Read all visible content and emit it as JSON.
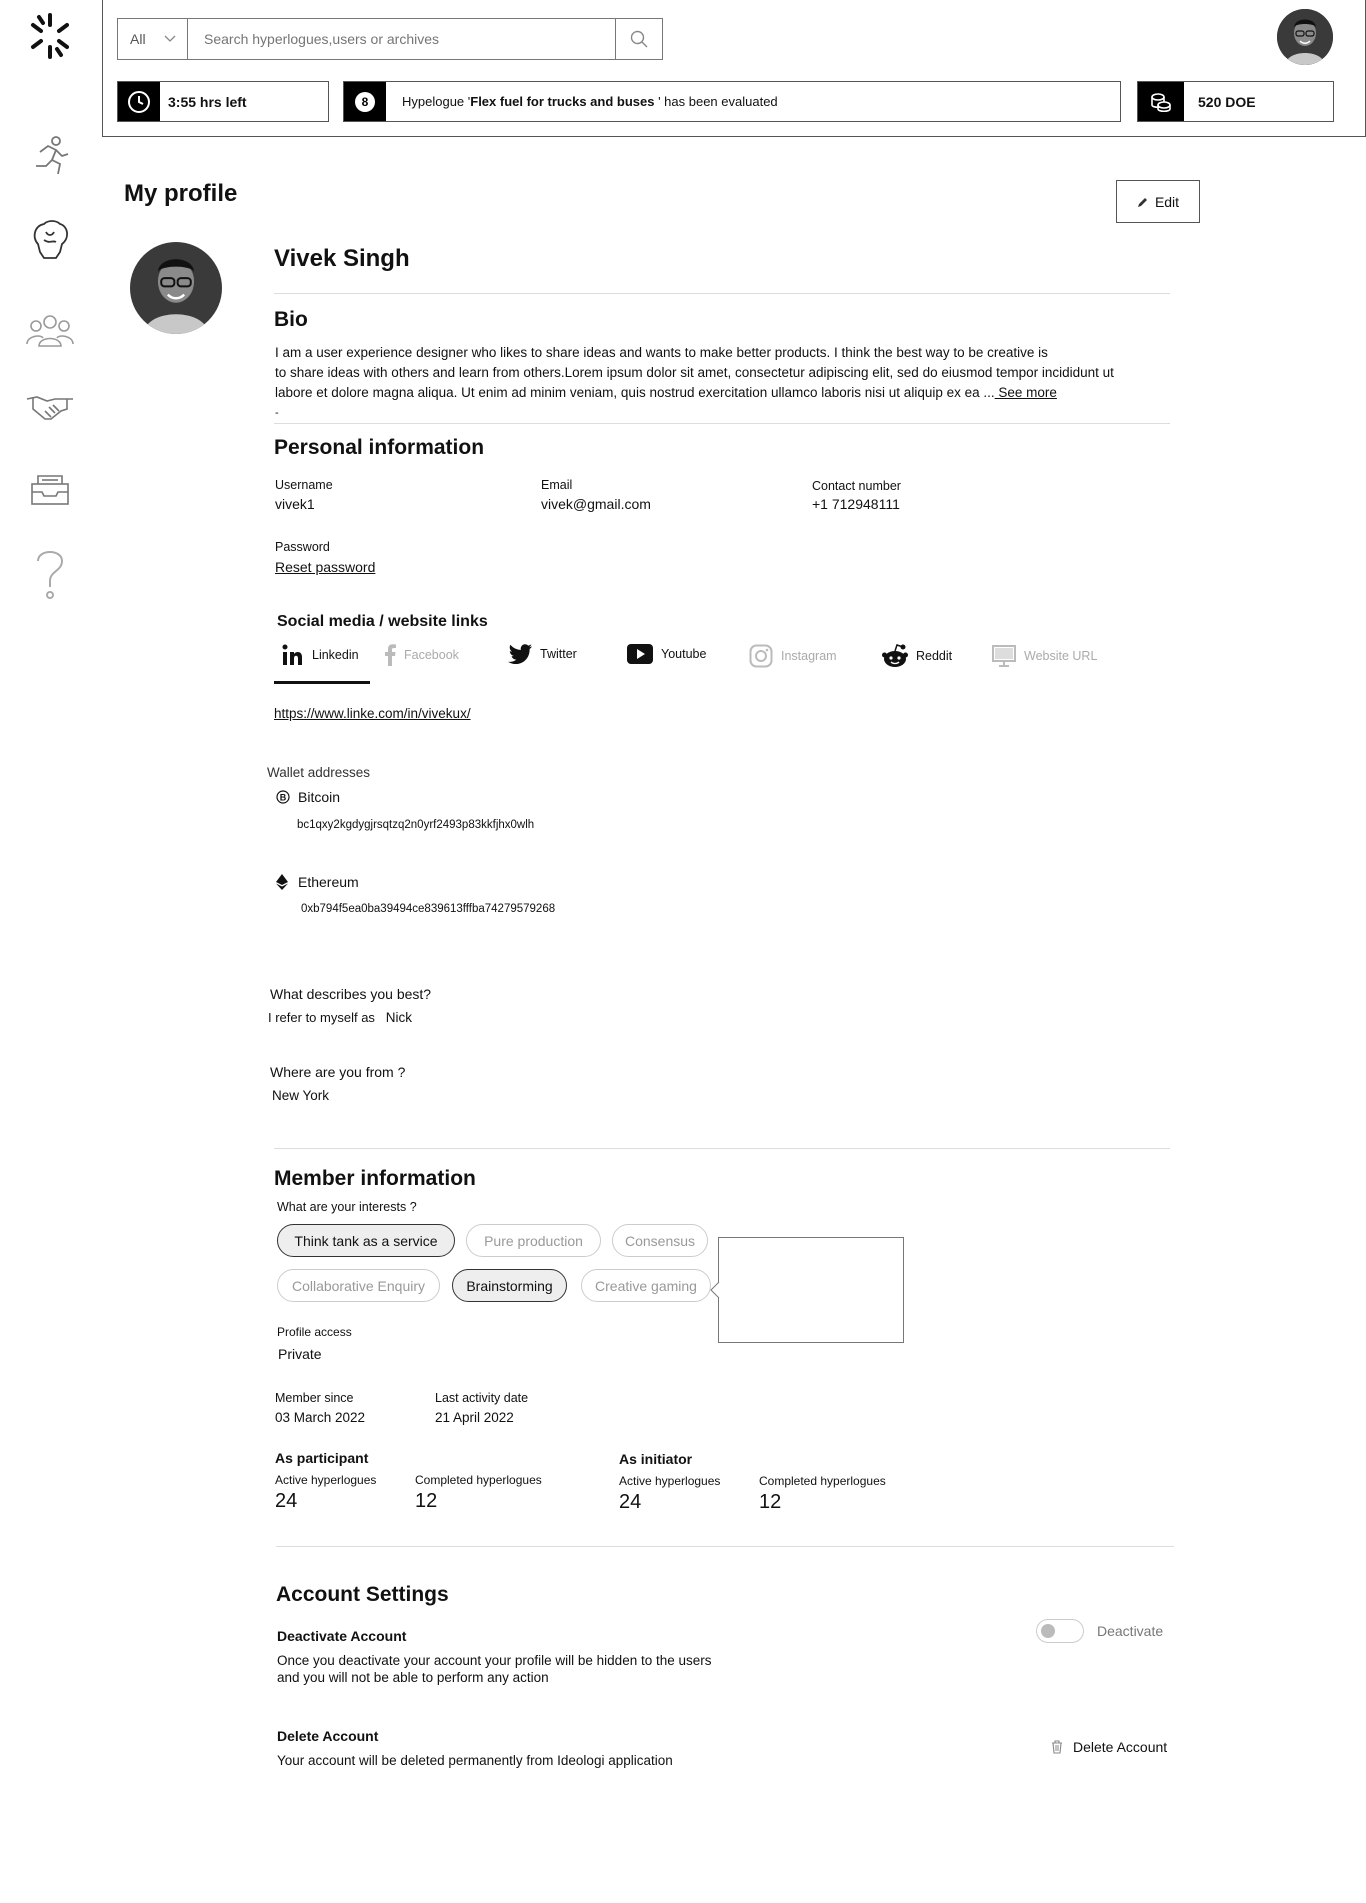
{
  "search": {
    "category": "All",
    "placeholder": "Search hyperlogues,users or archives"
  },
  "status": {
    "time_left": "3:55 hrs left",
    "notification_count": "8",
    "notification_prefix": "Hypelogue '",
    "notification_bold": "Flex fuel for trucks and buses",
    "notification_suffix": " ' has been evaluated",
    "balance": "520 DOE"
  },
  "page": {
    "title": "My profile",
    "edit_label": "Edit"
  },
  "profile": {
    "name": "Vivek Singh",
    "bio_heading": "Bio",
    "bio_line1": "I am a user experience designer who likes to share ideas and wants to make better products. I think the best way to be creative is",
    "bio_line2": "to share ideas with others and learn from others.Lorem ipsum dolor sit amet, consectetur adipiscing elit, sed do eiusmod tempor incididunt ut",
    "bio_line3": "labore et dolore magna aliqua. Ut enim ad minim veniam, quis nostrud exercitation ullamco laboris nisi ut aliquip ex ea ...",
    "see_more": " See more",
    "bio_dash": "-"
  },
  "personal": {
    "heading": "Personal information",
    "username_label": "Username",
    "username": "vivek1",
    "email_label": "Email",
    "email": "vivek@gmail.com",
    "contact_label": "Contact number",
    "contact": "+1 712948111",
    "password_label": "Password",
    "reset": "Reset password"
  },
  "social": {
    "heading": "Social media / website links",
    "tabs": [
      {
        "label": "Linkedin"
      },
      {
        "label": "Facebook"
      },
      {
        "label": "Twitter"
      },
      {
        "label": "Youtube"
      },
      {
        "label": "Instagram"
      },
      {
        "label": "Reddit"
      },
      {
        "label": "Website URL"
      }
    ],
    "active_link": "https://www.linke.com/in/vivekux/"
  },
  "wallet": {
    "heading": "Wallet addresses",
    "bitcoin_label": "Bitcoin",
    "bitcoin": "bc1qxy2kgdygjrsqtzq2n0yrf2493p83kkfjhx0wlh",
    "ethereum_label": "Ethereum",
    "ethereum": "0xb794f5ea0ba39494ce839613fffba74279579268"
  },
  "about": {
    "describe_q": "What describes you best?",
    "describe_prefix": "I refer to myself as",
    "describe_val": "Nick",
    "from_q": "Where are you from ?",
    "from_val": "New York"
  },
  "member": {
    "heading": "Member information",
    "interests_q": "What are your interests ?",
    "interests": [
      "Think tank as a service",
      "Pure production",
      "Consensus",
      "Collaborative Enquiry",
      "Brainstorming",
      "Creative gaming"
    ],
    "access_label": "Profile access",
    "access": "Private",
    "since_label": "Member since",
    "since": "03 March 2022",
    "activity_label": "Last activity date",
    "activity": "21 April 2022",
    "participant": "As participant",
    "initiator": "As initiator",
    "active_label": "Active hyperlogues",
    "completed_label": "Completed hyperlogues",
    "p_active": "24",
    "p_completed": "12",
    "i_active": "24",
    "i_completed": "12"
  },
  "account": {
    "heading": "Account Settings",
    "deactivate_title": "Deactivate Account",
    "deactivate_line1": "Once you deactivate your account your profile will be hidden to the users",
    "deactivate_line2": "and you will not be able to perform any action",
    "deactivate_toggle": "Deactivate",
    "delete_title": "Delete Account",
    "delete_desc": "Your account will be deleted permanently from Ideologi application",
    "delete_btn": "Delete Account"
  }
}
